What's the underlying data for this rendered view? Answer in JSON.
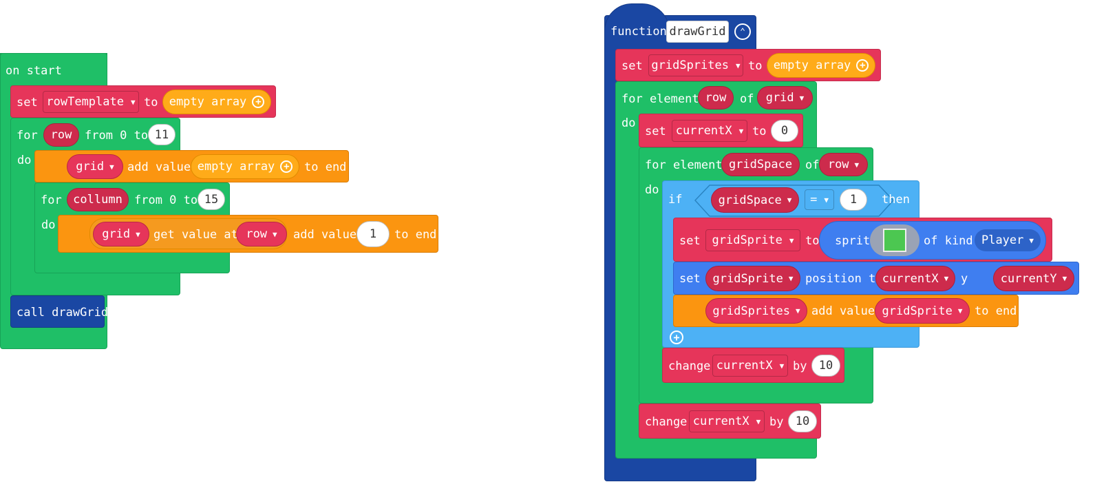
{
  "on_start": {
    "hat_label": "on start",
    "set_rowtemplate": {
      "set": "set",
      "var": "rowTemplate",
      "to": "to",
      "value": "empty array"
    },
    "for_row": {
      "for": "for",
      "var": "row",
      "from": "from 0 to",
      "end": "11",
      "do": "do"
    },
    "add_grid": {
      "var": "grid",
      "add": "add value",
      "value": "empty array",
      "to_end": "to end"
    },
    "for_col": {
      "for": "for",
      "var": "collumn",
      "from": "from 0 to",
      "end": "15",
      "do": "do"
    },
    "add_row": {
      "var": "grid",
      "get": "get value at",
      "index": "row",
      "add": "add value",
      "value": "1",
      "to_end": "to end"
    },
    "call": "call drawGrid"
  },
  "function": {
    "label": "function",
    "name": "drawGrid",
    "set_sprites": {
      "set": "set",
      "var": "gridSprites",
      "to": "to",
      "value": "empty array"
    },
    "for_row": {
      "for": "for element",
      "var": "row",
      "of": "of",
      "arr": "grid",
      "do": "do"
    },
    "set_x": {
      "set": "set",
      "var": "currentX",
      "to": "to",
      "value": "0"
    },
    "for_space": {
      "for": "for element",
      "var": "gridSpace",
      "of": "of",
      "arr": "row",
      "do": "do"
    },
    "if": {
      "if": "if",
      "lhs": "gridSpace",
      "op": "=",
      "rhs": "1",
      "then": "then"
    },
    "set_sprite": {
      "set": "set",
      "var": "gridSprite",
      "to": "to",
      "sprite": "sprite",
      "kind_label": "of kind",
      "kind": "Player"
    },
    "set_pos": {
      "set": "set",
      "var": "gridSprite",
      "pos": "position to x",
      "x": "currentX",
      "y_label": "y",
      "y": "currentY"
    },
    "add_sprite": {
      "var": "gridSprites",
      "add": "add value",
      "value": "gridSprite",
      "to_end": "to end"
    },
    "change_inner": {
      "change": "change",
      "var": "currentX",
      "by": "by",
      "value": "10"
    },
    "change_outer": {
      "change": "change",
      "var": "currentX",
      "by": "by",
      "value": "10"
    }
  },
  "colors": {
    "loops": "#1fbf67",
    "variables": "#e6355a",
    "arrays": "#fb9510",
    "functions": "#1a47a3",
    "logic": "#4db1f5",
    "sprites": "#3f7ef0"
  }
}
